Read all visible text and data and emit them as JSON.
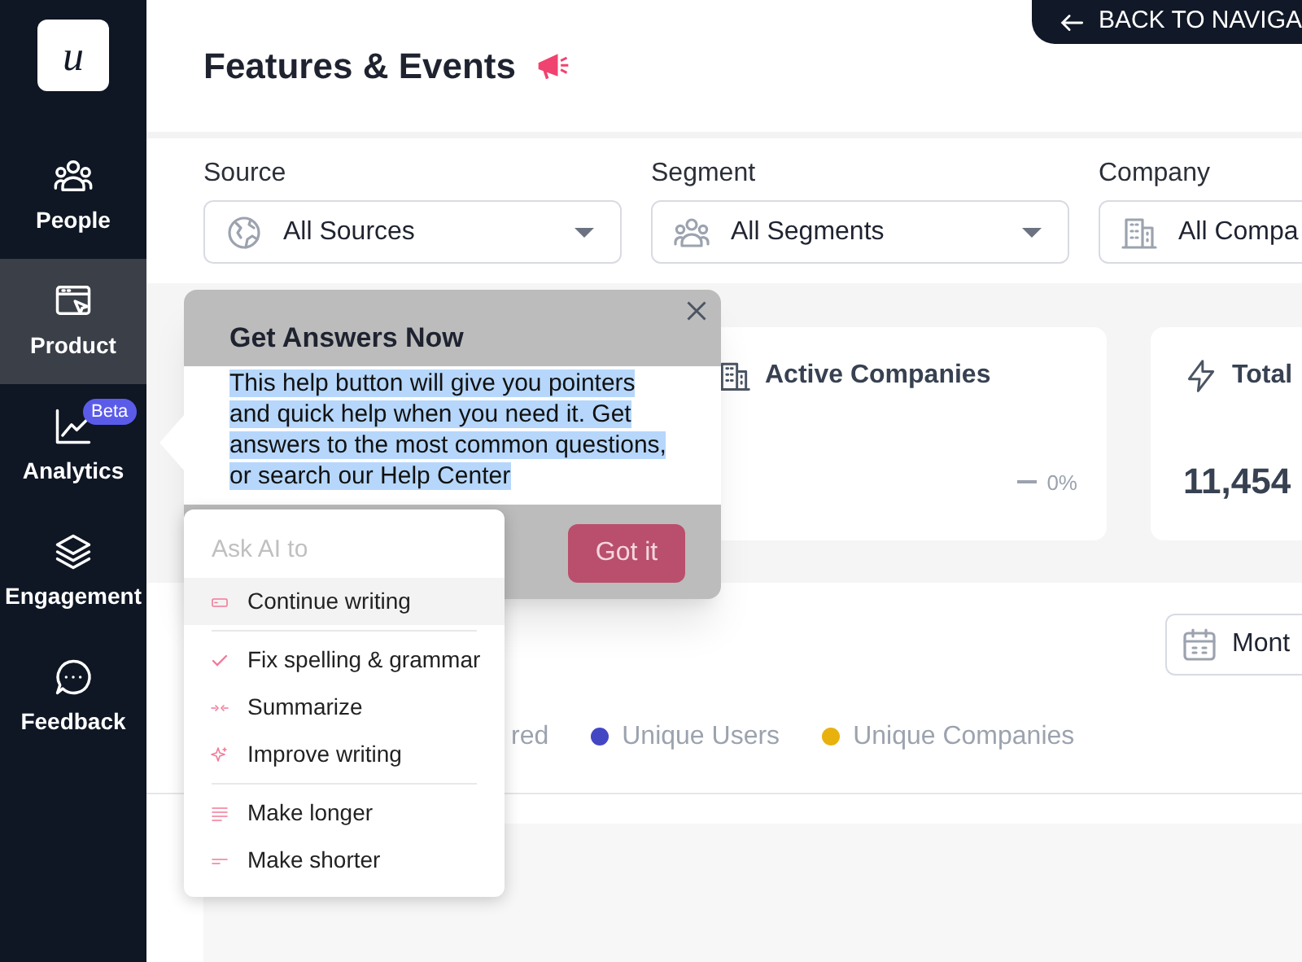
{
  "sidebar": {
    "logo": "u",
    "items": [
      {
        "label": "People",
        "selected": false
      },
      {
        "label": "Product",
        "selected": true
      },
      {
        "label": "Analytics",
        "selected": false,
        "badge": "Beta"
      },
      {
        "label": "Engagement",
        "selected": false
      },
      {
        "label": "Feedback",
        "selected": false
      }
    ]
  },
  "header": {
    "title": "Features & Events",
    "back_button": "BACK TO NAVIGA"
  },
  "filters": [
    {
      "label": "Source",
      "value": "All Sources"
    },
    {
      "label": "Segment",
      "value": "All Segments"
    },
    {
      "label": "Company",
      "value": "All Compa"
    }
  ],
  "stat_cards": [
    {
      "title": "Active Companies",
      "change": "0%"
    },
    {
      "title": "Total",
      "value": "11,454"
    }
  ],
  "chart_panel": {
    "date_button": "Mont",
    "legend": [
      {
        "label": "red"
      },
      {
        "label": "Unique Users",
        "color": "#4447c4"
      },
      {
        "label": "Unique Companies",
        "color": "#e8b10e"
      }
    ]
  },
  "tooltip": {
    "title": "Get Answers Now",
    "body": "This help button will give you pointers and quick help when you need it. Get answers to the most common questions, or search our Help Center",
    "button": "Got it"
  },
  "ai_menu": {
    "placeholder": "Ask AI to",
    "groups": [
      [
        {
          "label": "Continue writing",
          "highlighted": true
        }
      ],
      [
        {
          "label": "Fix spelling & grammar",
          "highlighted": false
        },
        {
          "label": "Summarize",
          "highlighted": false
        },
        {
          "label": "Improve writing",
          "highlighted": false
        }
      ],
      [
        {
          "label": "Make longer",
          "highlighted": false
        },
        {
          "label": "Make shorter",
          "highlighted": false
        }
      ]
    ]
  }
}
